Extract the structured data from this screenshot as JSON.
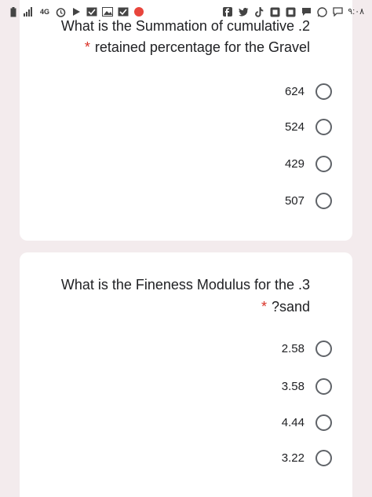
{
  "status_bar": {
    "time": "٩:٠٨",
    "network": "4G"
  },
  "question1": {
    "line1": "What is the Summation of cumulative .2",
    "required_mark": "*",
    "line2": "retained percentage for the Gravel",
    "options": [
      {
        "label": "624"
      },
      {
        "label": "524"
      },
      {
        "label": "429"
      },
      {
        "label": "507"
      }
    ]
  },
  "question2": {
    "line1": "What is the Fineness Modulus for the .3",
    "required_mark": "*",
    "line2": "?sand",
    "options": [
      {
        "label": "2.58"
      },
      {
        "label": "3.58"
      },
      {
        "label": "4.44"
      },
      {
        "label": "3.22"
      }
    ]
  },
  "colors": {
    "background": "#f3ebed",
    "card": "#ffffff",
    "required": "#d93025",
    "radio_border": "#5f6368"
  }
}
